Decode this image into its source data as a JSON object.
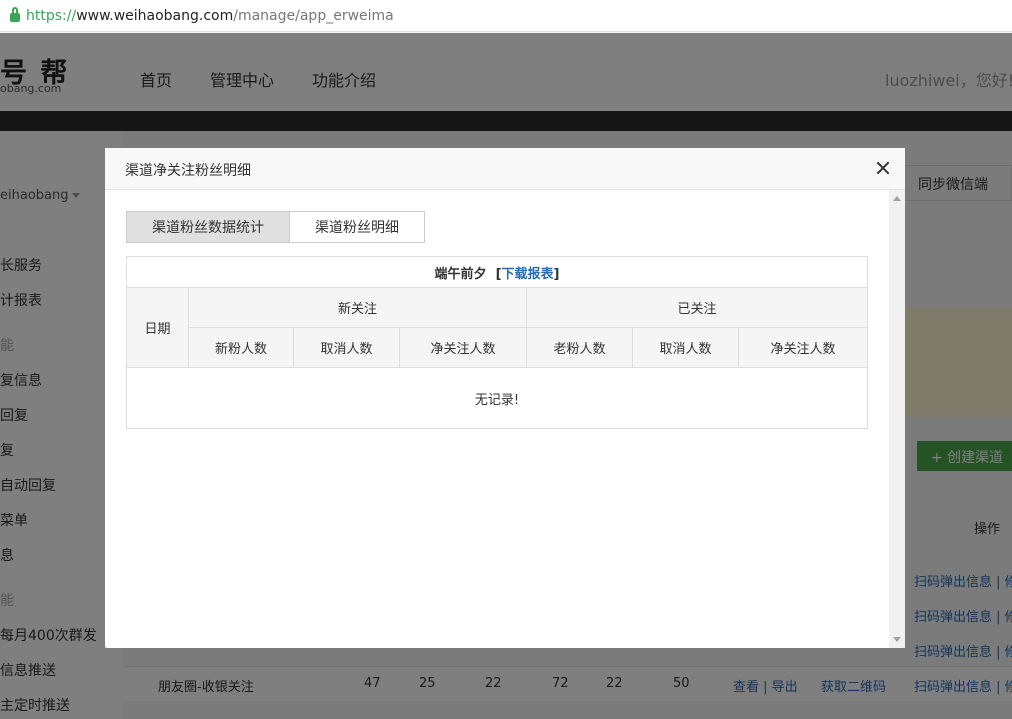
{
  "browser": {
    "url_scheme": "https://",
    "url_host": "www.weihaobang.com",
    "url_path": "/manage/app_erweima"
  },
  "header": {
    "logo_main": "号 帮",
    "logo_sub": "obang.com",
    "nav": [
      "首页",
      "管理中心",
      "功能介绍"
    ],
    "user": "luozhiwei，您好!"
  },
  "sidebar": {
    "account": "eihaobang",
    "items": [
      {
        "label": "长服务",
        "group": false
      },
      {
        "label": "计报表",
        "group": false
      },
      {
        "label": "能",
        "group": true
      },
      {
        "label": "复信息",
        "group": false
      },
      {
        "label": "回复",
        "group": false
      },
      {
        "label": "复",
        "group": false
      },
      {
        "label": "自动回复",
        "group": false
      },
      {
        "label": "菜单",
        "group": false
      },
      {
        "label": "息",
        "group": false
      },
      {
        "label": "能",
        "group": true
      },
      {
        "label": "每月400次群发",
        "group": false
      },
      {
        "label": "信息推送",
        "group": false
      },
      {
        "label": "主定时推送",
        "group": false
      }
    ]
  },
  "background": {
    "sync_button": "同步微信端",
    "create_button": "+ 创建渠道",
    "op_header": "操作",
    "op_link": "扫码弹出信息 | 修",
    "rows": [
      {
        "name": "朋友圈-收银关注",
        "c1": "47",
        "c2": "25",
        "c3": "22",
        "c4": "72",
        "c5": "22",
        "c6": "50",
        "view": "查看 | 导出",
        "qr": "获取二维码"
      }
    ]
  },
  "modal": {
    "title": "渠道净关注粉丝明细",
    "tabs": [
      "渠道粉丝数据统计",
      "渠道粉丝明细"
    ],
    "table": {
      "caption": "端午前夕",
      "download": "下载报表",
      "date_col": "日期",
      "group_new": "新关注",
      "group_existing": "已关注",
      "sub_cols": [
        "新粉人数",
        "取消人数",
        "净关注人数",
        "老粉人数",
        "取消人数",
        "净关注人数"
      ],
      "empty_text": "无记录!"
    }
  }
}
